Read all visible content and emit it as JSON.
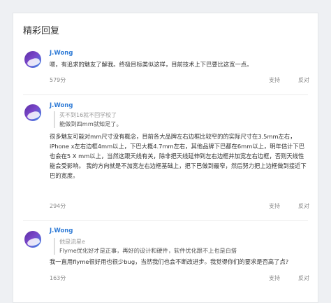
{
  "section": {
    "title": "精彩回复"
  },
  "comments": [
    {
      "user": "J.Wong",
      "body": "嗯，有追求的魅友了解我。终极目标类似这样，目前技术上下巴要比这宽一点。",
      "likes": "579分",
      "support_label": "支持",
      "oppose_label": "反对"
    },
    {
      "user": "J.Wong",
      "quote_author": "买不到16就不回学校了",
      "quote_text": "能做到四mm就知足了。",
      "body": "很多魅友可能对mm尺寸没有概念，目前各大品牌左右边框比较窄的的实际尺寸在3.5mm左右，iPhone x左右边框4mm以上，下巴大概4.7mm左右，其他品牌下巴都在6mm以上，明年估计下巴也会在5 X mm以上，当然这跟天线有关，除非把天线延伸到左右边框并加宽左右边框，否则天线性能会受影响。 我的方向就是不加宽左右边框基础上，把下巴做到最窄，然后努力把上边框做到接近下巴的宽度。",
      "likes": "294分",
      "support_label": "支持",
      "oppose_label": "反对"
    },
    {
      "user": "J.Wong",
      "quote_author": "他是流星e",
      "quote_text": "Flyme优化好才是正事，再好的设计和硬件，软件优化跟不上也是白搭",
      "body": "我一直用flyme很好用也很少bug，当然我们也会不断改进步。我觉得你们的要求是否高了点?",
      "likes": "163分",
      "support_label": "支持",
      "oppose_label": "反对"
    }
  ]
}
